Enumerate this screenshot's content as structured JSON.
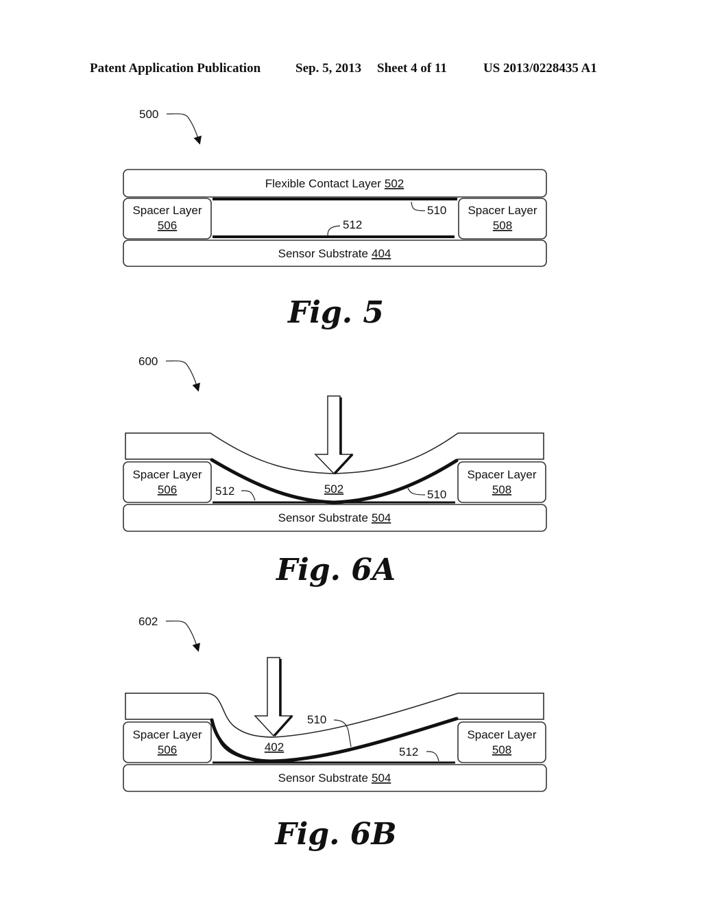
{
  "header": {
    "publication_type": "Patent Application Publication",
    "date": "Sep. 5, 2013",
    "sheet": "Sheet 4 of 11",
    "publication_number": "US 2013/0228435 A1"
  },
  "figures": [
    {
      "id": "fig5",
      "caption": "Fig. 5",
      "reference": "500",
      "layers": {
        "top": {
          "name": "Flexible Contact Layer",
          "number": "502"
        },
        "left_spacer": {
          "name": "Spacer Layer",
          "number": "506"
        },
        "right_spacer": {
          "name": "Spacer Layer",
          "number": "508"
        },
        "substrate": {
          "name": "Sensor Substrate",
          "number": "404"
        }
      },
      "callouts": [
        "510",
        "512"
      ]
    },
    {
      "id": "fig6a",
      "caption": "Fig. 6A",
      "reference": "600",
      "layers": {
        "top_number": "502",
        "left_spacer": {
          "name": "Spacer Layer",
          "number": "506"
        },
        "right_spacer": {
          "name": "Spacer Layer",
          "number": "508"
        },
        "substrate": {
          "name": "Sensor Substrate",
          "number": "504"
        }
      },
      "callouts": [
        "512",
        "510"
      ]
    },
    {
      "id": "fig6b",
      "caption": "Fig. 6B",
      "reference": "602",
      "layers": {
        "top_number": "402",
        "left_spacer": {
          "name": "Spacer Layer",
          "number": "506"
        },
        "right_spacer": {
          "name": "Spacer Layer",
          "number": "508"
        },
        "substrate": {
          "name": "Sensor Substrate",
          "number": "504"
        }
      },
      "callouts": [
        "510",
        "512"
      ]
    }
  ]
}
